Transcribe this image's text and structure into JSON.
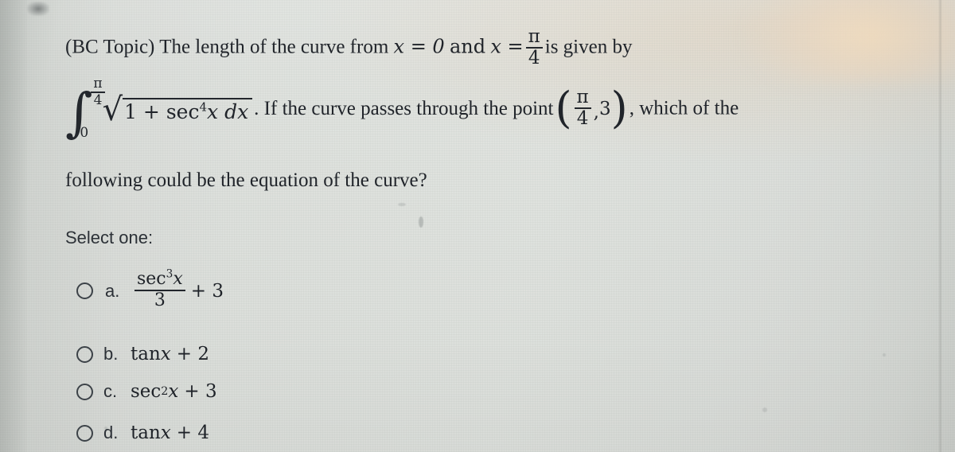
{
  "question": {
    "topic_tag": "(BC Topic)",
    "line1_before": "The length of the curve from",
    "x_lower_eq": "x = 0",
    "and_word": "and",
    "x_upper_var": "x =",
    "upper_limit_num": "π",
    "upper_limit_den": "4",
    "line1_after": "is given by",
    "integral": {
      "sign": "∫",
      "lower": "0",
      "upper_num": "π",
      "upper_den": "4",
      "radical": "√",
      "radicand_one": "1 + sec",
      "radicand_exp": "4",
      "radicand_var": "x",
      "differential": "dx"
    },
    "line2_middle": ". If the curve passes through the point",
    "point": {
      "open_paren": "(",
      "x_num": "π",
      "x_den": "4",
      "separator": ",",
      "y": "3",
      "close_paren": ")"
    },
    "line2_after": ", which of the",
    "line3": "following could be the equation of the curve?"
  },
  "select_prompt": "Select one:",
  "options": [
    {
      "letter": "a.",
      "type": "fraction",
      "num_base": "sec",
      "num_exp": "3",
      "num_var": "x",
      "den": "3",
      "tail": "+ 3",
      "text": "sec³x / 3 + 3",
      "selected": false
    },
    {
      "letter": "b.",
      "type": "plain",
      "base": "tan",
      "var": "x",
      "tail": "+ 2",
      "text": "tanx + 2",
      "selected": false
    },
    {
      "letter": "c.",
      "type": "power",
      "base": "sec",
      "exp": "2",
      "var": "x",
      "tail": "+ 3",
      "text": "sec²x + 3",
      "selected": false
    },
    {
      "letter": "d.",
      "type": "plain",
      "base": "tan",
      "var": "x",
      "tail": "+ 4",
      "text": "tanx + 4",
      "selected": false
    }
  ],
  "colors": {
    "background": "#dcdfdb",
    "text": "#20242a",
    "radio_border": "#3a4046",
    "glare": "#ebd6bb"
  }
}
